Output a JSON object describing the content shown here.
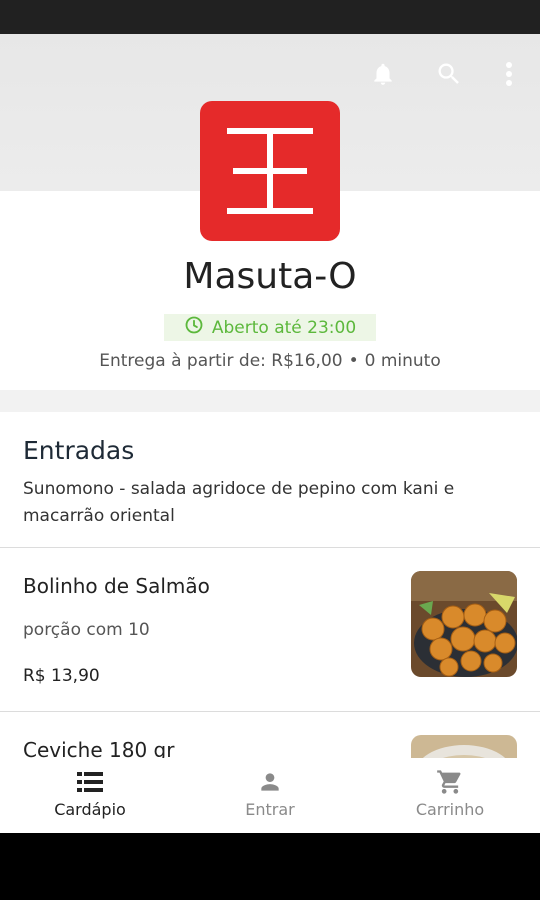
{
  "store": {
    "name": "Masuta-O",
    "open_status": "Aberto até 23:00",
    "delivery_label": "Entrega à partir de: R$16,00",
    "delivery_separator": "•",
    "delivery_time": "0 minuto",
    "brand_color": "#e52a2a",
    "open_color": "#5cb83c"
  },
  "header_icons": [
    "bell-icon",
    "search-icon",
    "more-vertical-icon"
  ],
  "section": {
    "title": "Entradas",
    "description": "Sunomono - salada agridoce de pepino com kani e macarrão oriental"
  },
  "items": [
    {
      "name": "Bolinho de Salmão",
      "description": "porção com 10",
      "price": "R$ 13,90"
    },
    {
      "name": "Ceviche 180 gr"
    }
  ],
  "nav": [
    {
      "label": "Cardápio",
      "icon": "menu-list-icon",
      "active": true
    },
    {
      "label": "Entrar",
      "icon": "person-icon",
      "active": false
    },
    {
      "label": "Carrinho",
      "icon": "cart-icon",
      "active": false
    }
  ]
}
